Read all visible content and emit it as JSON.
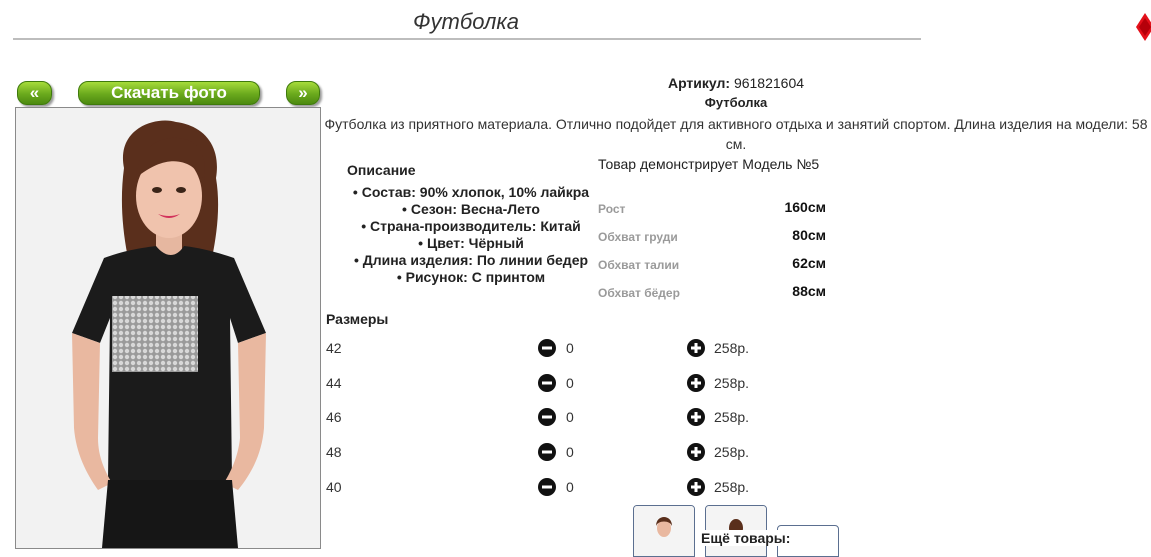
{
  "header": {
    "title": "Футболка"
  },
  "gallery": {
    "prev_label": "«",
    "download_label": "Скачать фото",
    "next_label": "»"
  },
  "product": {
    "article_label": "Артикул:",
    "article_value": "961821604",
    "name": "Футболка",
    "description": "Футболка из приятного материала. Отлично подойдет для активного отдыха и занятий спортом. Длина изделия на модели: 58 см."
  },
  "specs": {
    "heading": "Описание",
    "items": [
      "Состав: 90% хлопок, 10% лайкра",
      "Сезон: Весна-Лето",
      "Страна-производитель: Китай",
      "Цвет: Чёрный",
      "Длина изделия: По линии бедер",
      "Рисунок: С принтом"
    ]
  },
  "model": {
    "heading": "Товар демонстрирует Модель №5",
    "measurements": [
      {
        "label": "Рост",
        "value": "160см"
      },
      {
        "label": "Обхват груди",
        "value": "80см"
      },
      {
        "label": "Обхват талии",
        "value": "62см"
      },
      {
        "label": "Обхват бёдер",
        "value": "88см"
      }
    ]
  },
  "sizes": {
    "heading": "Размеры",
    "rows": [
      {
        "size": "42",
        "qty": "0",
        "price": "258р."
      },
      {
        "size": "44",
        "qty": "0",
        "price": "258р."
      },
      {
        "size": "46",
        "qty": "0",
        "price": "258р."
      },
      {
        "size": "48",
        "qty": "0",
        "price": "258р."
      },
      {
        "size": "40",
        "qty": "0",
        "price": "258р."
      }
    ]
  },
  "footer": {
    "more_label": "Ещё товары:"
  },
  "colors": {
    "accent_green": "#6aa91d",
    "close_red": "#e3101a"
  }
}
